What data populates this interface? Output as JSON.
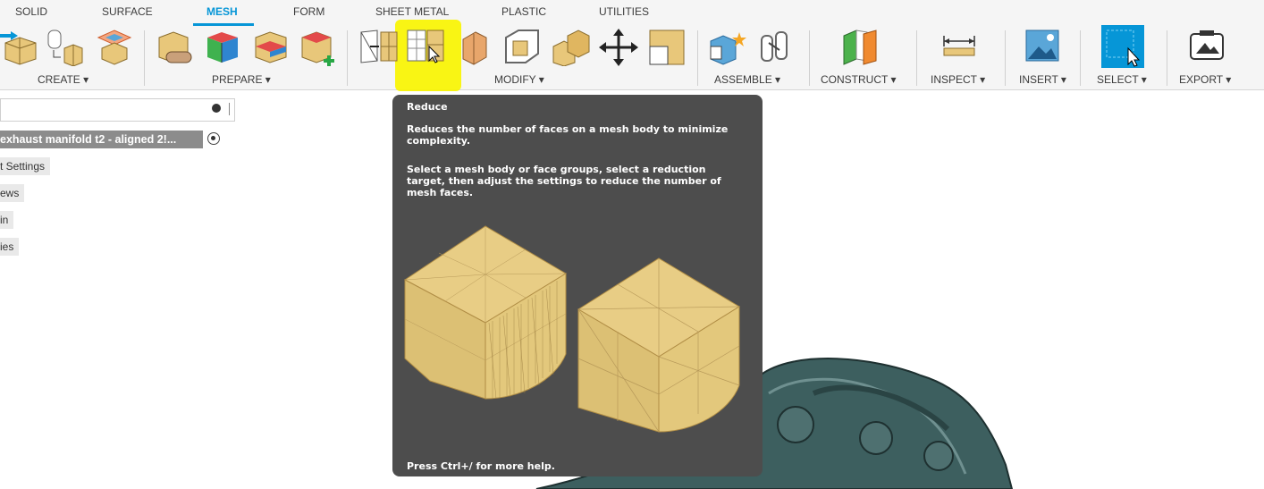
{
  "tabs": [
    "SOLID",
    "SURFACE",
    "MESH",
    "FORM",
    "SHEET METAL",
    "PLASTIC",
    "UTILITIES"
  ],
  "active_tab": "MESH",
  "groups": {
    "create": "CREATE ▾",
    "prepare": "PREPARE ▾",
    "modify": "MODIFY ▾",
    "assemble": "ASSEMBLE ▾",
    "construct": "CONSTRUCT ▾",
    "inspect": "INSPECT ▾",
    "insert": "INSERT ▾",
    "select": "SELECT ▾",
    "export": "EXPORT ▾"
  },
  "browser": {
    "root_label": "exhaust manifold t2 - aligned 2!...",
    "items": [
      "t Settings",
      "ews",
      "in",
      "ies"
    ]
  },
  "tooltip": {
    "title": "Reduce",
    "description": "Reduces the number of faces on a mesh body to minimize complexity.",
    "instructions": "Select a mesh body or face groups, select a reduction target, then adjust the settings to reduce the number of mesh faces.",
    "footer": "Press Ctrl+/ for more help."
  },
  "colors": {
    "accent": "#0696d7",
    "tooltip_bg": "#4d4d4d",
    "highlight": "#f8f400",
    "mesh_tan": "#e8c77a"
  }
}
